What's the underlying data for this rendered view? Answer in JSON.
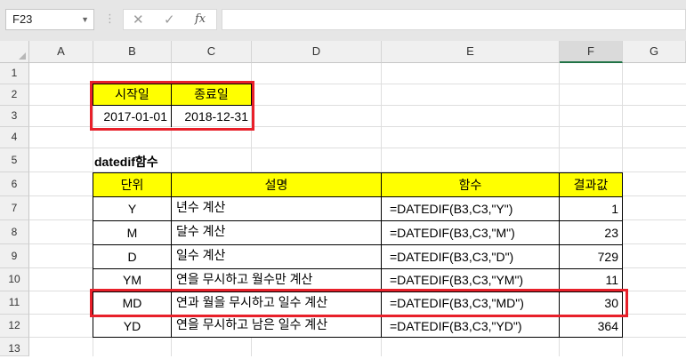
{
  "formula_bar": {
    "name_box": "F23",
    "cancel_icon": "✕",
    "enter_icon": "✓",
    "fx_label": "fx",
    "formula": ""
  },
  "columns": [
    "A",
    "B",
    "C",
    "D",
    "E",
    "F",
    "G"
  ],
  "rows": [
    "1",
    "2",
    "3",
    "4",
    "5",
    "6",
    "7",
    "8",
    "9",
    "10",
    "11",
    "12",
    "13"
  ],
  "dates": {
    "header_start": "시작일",
    "header_end": "종료일",
    "start": "2017-01-01",
    "end": "2018-12-31"
  },
  "section_title": "datedif함수",
  "table": {
    "headers": [
      "단위",
      "설명",
      "함수",
      "결과값"
    ],
    "rows": [
      {
        "unit": "Y",
        "desc": "년수 계산",
        "formula": "=DATEDIF(B3,C3,\"Y\")",
        "result": "1"
      },
      {
        "unit": "M",
        "desc": "달수 계산",
        "formula": "=DATEDIF(B3,C3,\"M\")",
        "result": "23"
      },
      {
        "unit": "D",
        "desc": "일수 계산",
        "formula": "=DATEDIF(B3,C3,\"D\")",
        "result": "729"
      },
      {
        "unit": "YM",
        "desc": "연을 무시하고 월수만 계산",
        "formula": "=DATEDIF(B3,C3,\"YM\")",
        "result": "11"
      },
      {
        "unit": "MD",
        "desc": "연과 월을 무시하고 일수 계산",
        "formula": "=DATEDIF(B3,C3,\"MD\")",
        "result": "30"
      },
      {
        "unit": "YD",
        "desc": "연을 무시하고 남은 일수 계산",
        "formula": "=DATEDIF(B3,C3,\"YD\")",
        "result": "364"
      }
    ]
  },
  "colors": {
    "header_fill": "#ffff00",
    "highlight": "#e8202a",
    "selected_col_accent": "#217346"
  }
}
